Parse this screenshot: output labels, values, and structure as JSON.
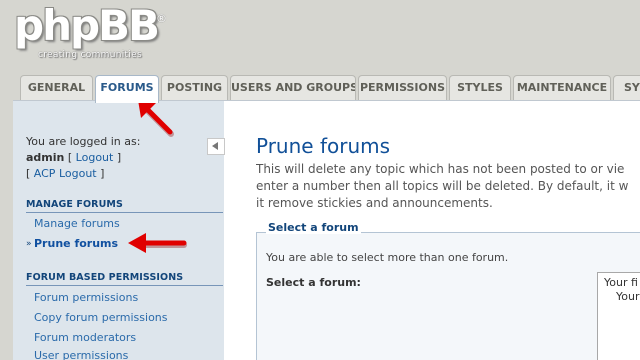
{
  "logo": {
    "text": "phpBB",
    "reg": "®",
    "tagline": "creating communities"
  },
  "tabs": [
    "GENERAL",
    "FORUMS",
    "POSTING",
    "USERS AND GROUPS",
    "PERMISSIONS",
    "STYLES",
    "MAINTENANCE",
    "SYS"
  ],
  "active_tab": "FORUMS",
  "sidebar": {
    "logged_in_label": "You are logged in as:",
    "username": "admin",
    "logout_label": "Logout",
    "acp_logout_label": "ACP Logout",
    "manage_heading": "MANAGE FORUMS",
    "manage_items": [
      "Manage forums",
      "Prune forums"
    ],
    "active_item": "Prune forums",
    "perm_heading": "FORUM BASED PERMISSIONS",
    "perm_items": [
      "Forum permissions",
      "Copy forum permissions",
      "Forum moderators",
      "User permissions"
    ]
  },
  "main": {
    "title": "Prune forums",
    "desc_lines": [
      "This will delete any topic which has not been posted to or vie",
      "enter a number then all topics will be deleted. By default, it w",
      "it remove stickies and announcements."
    ],
    "fieldset_legend": "Select a forum",
    "hint": "You are able to select more than one forum.",
    "field_label": "Select a forum:",
    "select_options": [
      "Your fi",
      "Your"
    ]
  },
  "colors": {
    "arrow": "#e00000",
    "accent": "#115098",
    "sidebar_bg": "#dde5ec"
  }
}
